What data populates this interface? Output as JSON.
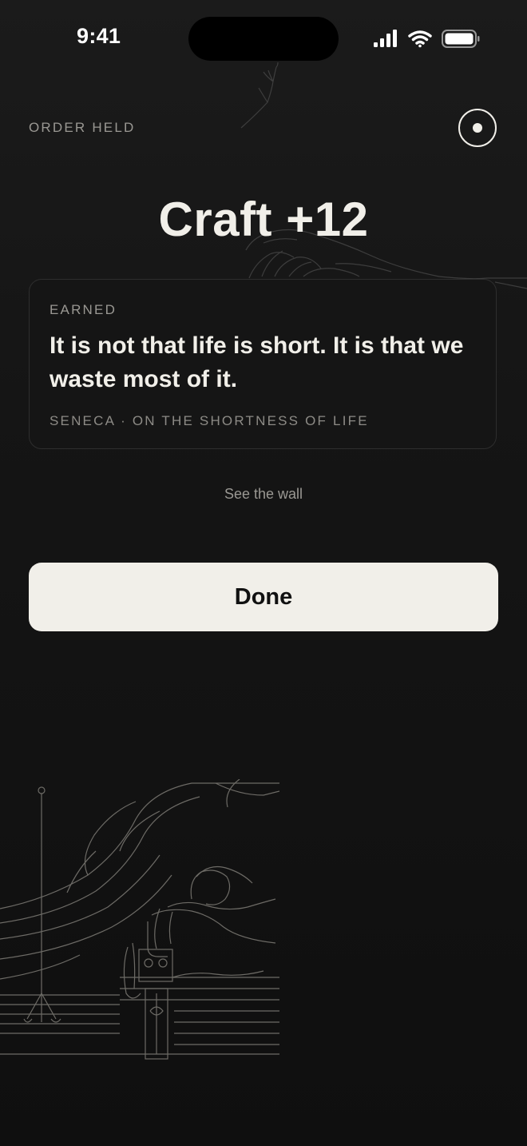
{
  "status_bar": {
    "time": "9:41",
    "icons": [
      "cellular-signal-icon",
      "wifi-icon",
      "battery-icon"
    ]
  },
  "header": {
    "order_label": "ORDER HELD",
    "record_icon": "record-icon"
  },
  "title": "Craft +12",
  "quote_card": {
    "label": "EARNED",
    "quote": "It is not that life is short. It is that we waste most of it.",
    "source": "SENECA · ON THE SHORTNESS OF LIFE"
  },
  "links": {
    "see_wall": "See the wall"
  },
  "actions": {
    "done_label": "Done"
  },
  "colors": {
    "background": "#111111",
    "text_primary": "#f1efe9",
    "text_muted": "#9a9893",
    "button_fill": "#f1efe9",
    "card_border": "#2e2e2e"
  }
}
